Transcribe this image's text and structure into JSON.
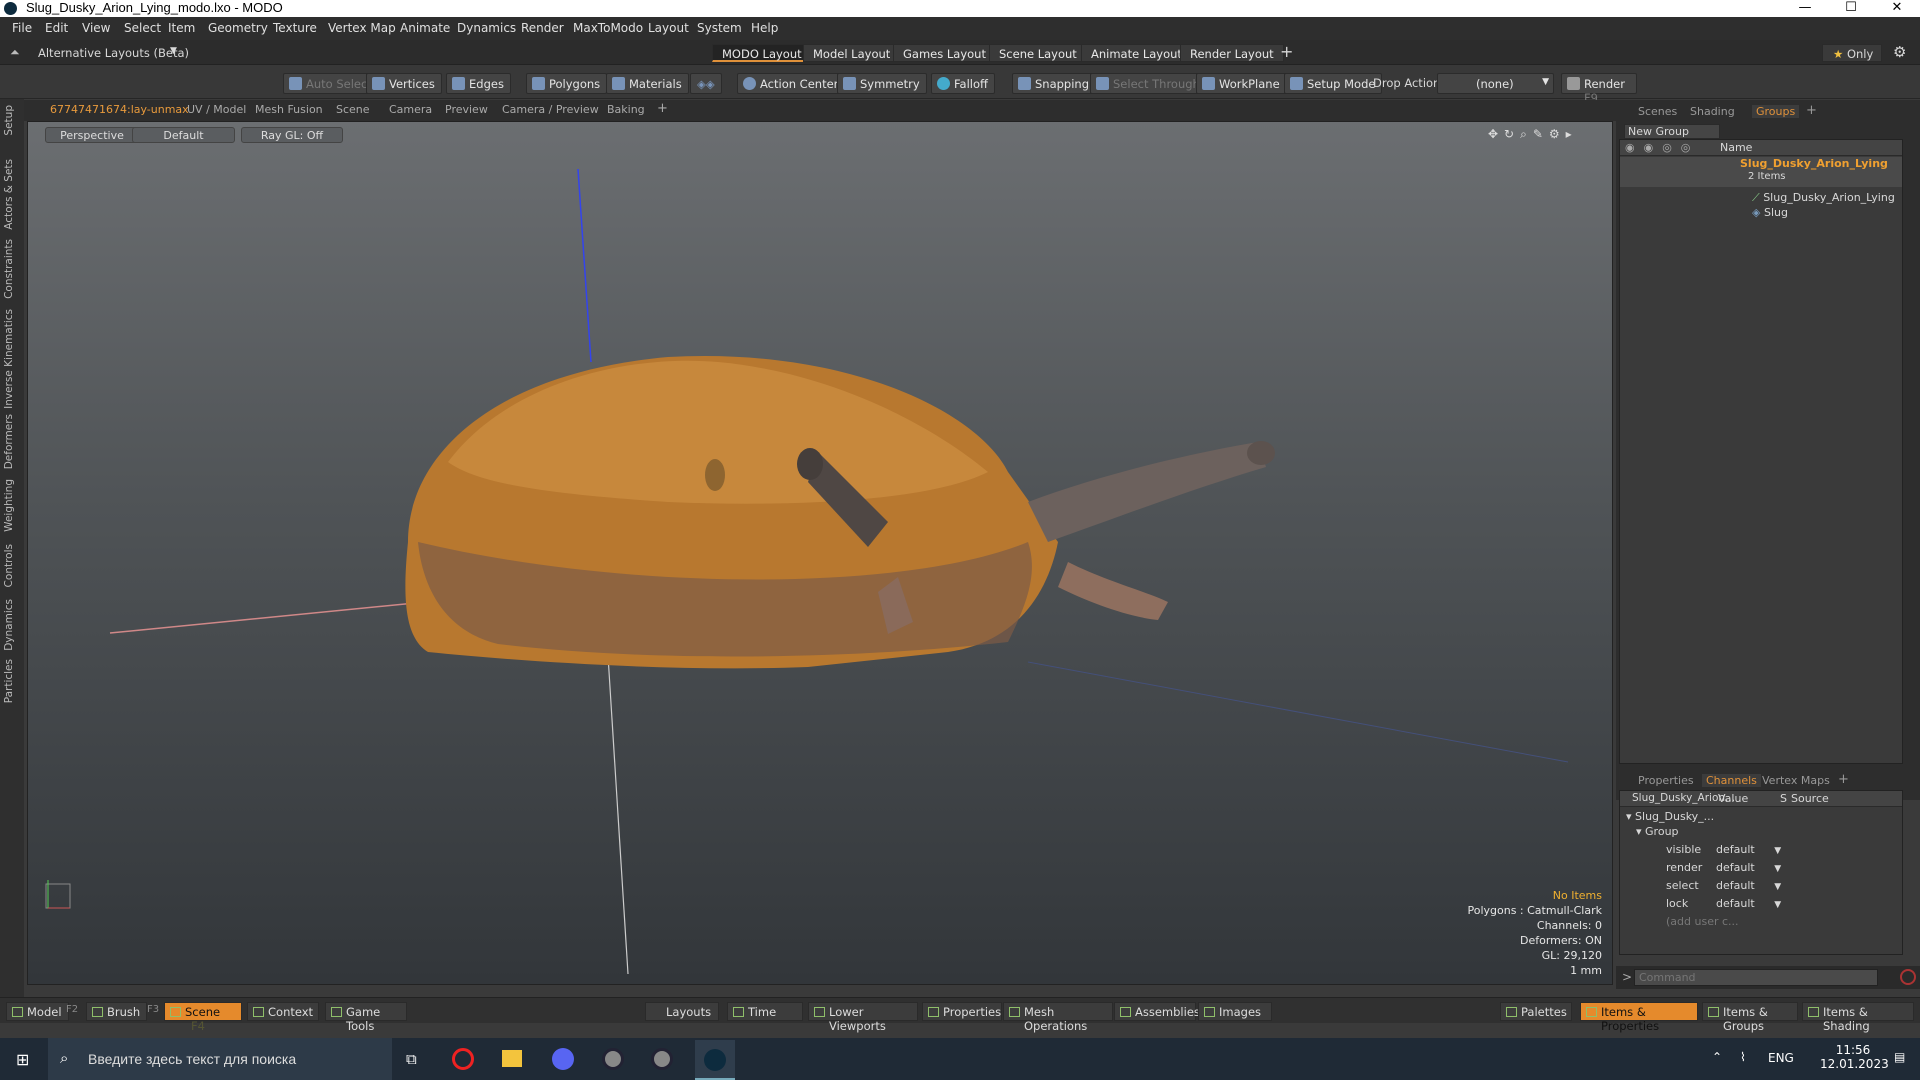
{
  "window": {
    "title": "Slug_Dusky_Arion_Lying_modo.lxo - MODO",
    "min": "—",
    "max": "☐",
    "close": "✕"
  },
  "menu": [
    "File",
    "Edit",
    "View",
    "Select",
    "Item",
    "Geometry",
    "Texture",
    "Vertex Map",
    "Animate",
    "Dynamics",
    "Render",
    "MaxToModo",
    "Layout",
    "System",
    "Help"
  ],
  "layouts": {
    "alt": "Alternative Layouts (Beta)",
    "tabs": [
      "MODO Layout",
      "Model Layout",
      "Games Layout",
      "Scene Layout",
      "Animate Layout",
      "Render Layout"
    ],
    "add": "+",
    "only": "Only"
  },
  "toolbar": {
    "auto_select": "Auto Select",
    "vertices": "Vertices",
    "edges": "Edges",
    "polygons": "Polygons",
    "materials": "Materials",
    "action_center": "Action Center",
    "symmetry": "Symmetry",
    "falloff": "Falloff",
    "snapping": "Snapping",
    "select_through": "Select Through",
    "workplane": "WorkPlane",
    "setup_mode": "Setup Mode",
    "drop_action": "Drop Action",
    "drop_value": "(none)",
    "render": "Render",
    "render_key": "F9"
  },
  "left_tabs": [
    "Setup",
    "Actors & Sets",
    "Constraints",
    "Inverse Kinematics",
    "Deformers",
    "Weighting",
    "Controls",
    "Dynamics",
    "Particles"
  ],
  "viewport_tabs": [
    "67747471674:lay-unmax",
    "UV / Model",
    "Mesh Fusion",
    "Scene",
    "Camera",
    "Preview",
    "Camera / Preview",
    "Baking",
    "+"
  ],
  "viewport": {
    "view": "Perspective",
    "shading": "Default",
    "raygl": "Ray GL: Off"
  },
  "hud": {
    "items": "No Items",
    "polygons": "Polygons : Catmull-Clark",
    "channels": "Channels: 0",
    "deformers": "Deformers: ON",
    "gl": "GL: 29,120",
    "scale": "1 mm"
  },
  "right_tabs": [
    "Scenes",
    "Shading",
    "Groups",
    "+"
  ],
  "groups": {
    "new_group": "New Group",
    "col_name": "Name",
    "group_name": "Slug_Dusky_Arion_Lying",
    "count": "2 Items",
    "items": [
      "Slug_Dusky_Arion_Lying",
      "Slug"
    ]
  },
  "bottom_tabs": [
    "Properties",
    "Channels",
    "Vertex Maps",
    "+"
  ],
  "channels": {
    "col_item": "Slug_Dusky_Arion...",
    "col_value": "Value",
    "col_s": "S",
    "col_source": "Source",
    "item": "Slug_Dusky_...",
    "group": "Group",
    "rows": [
      {
        "name": "visible",
        "value": "default"
      },
      {
        "name": "render",
        "value": "default"
      },
      {
        "name": "select",
        "value": "default"
      },
      {
        "name": "lock",
        "value": "default"
      }
    ],
    "add": "(add user c..."
  },
  "command": {
    "placeholder": "Command"
  },
  "bottom": {
    "model": "Model",
    "f2": "F2",
    "brush": "Brush",
    "f3": "F3",
    "scene": "Scene",
    "f4": "F4",
    "context": "Context",
    "game_tools": "Game Tools",
    "layouts": "Layouts",
    "time": "Time",
    "lower_viewports": "Lower Viewports",
    "properties": "Properties",
    "mesh_ops": "Mesh Operations",
    "assemblies": "Assemblies",
    "images": "Images",
    "palettes": "Palettes",
    "items_props": "Items & Properties",
    "items_groups": "Items & Groups",
    "items_shading": "Items & Shading"
  },
  "taskbar": {
    "search": "Введите здесь текст для поиска",
    "lang": "ENG",
    "time": "11:56",
    "date": "12.01.2023"
  }
}
